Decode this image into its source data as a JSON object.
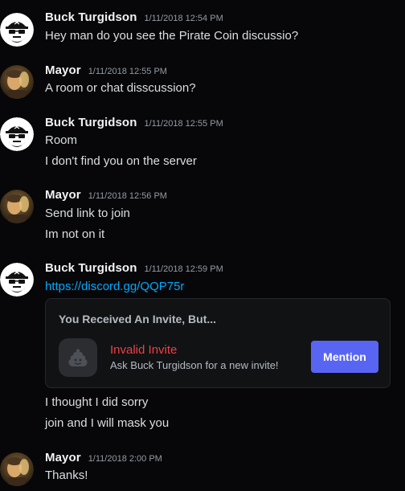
{
  "colors": {
    "background": "#070709",
    "username": "#f2f3f5",
    "timestamp": "#949ba4",
    "text": "#dbdee1",
    "link": "#00a8fc",
    "invalid": "#f23f42",
    "button": "#5865f2"
  },
  "messages": [
    {
      "author": "Buck Turgidson",
      "avatar": "pirate-skull-avatar",
      "timestamp": "1/11/2018 12:54 PM",
      "lines": [
        "Hey man do you see the Pirate Coin discussio?"
      ]
    },
    {
      "author": "Mayor",
      "avatar": "mayor-avatar",
      "timestamp": "1/11/2018 12:55 PM",
      "lines": [
        "A room or chat disscussion?"
      ]
    },
    {
      "author": "Buck Turgidson",
      "avatar": "pirate-skull-avatar",
      "timestamp": "1/11/2018 12:55 PM",
      "lines": [
        "Room",
        "I don't find you on the server"
      ]
    },
    {
      "author": "Mayor",
      "avatar": "mayor-avatar",
      "timestamp": "1/11/2018 12:56 PM",
      "lines": [
        "Send link to join",
        "Im not on it"
      ]
    },
    {
      "author": "Buck Turgidson",
      "avatar": "pirate-skull-avatar",
      "timestamp": "1/11/2018 12:59 PM",
      "link": "https://discord.gg/QQP75r",
      "invite": {
        "heading": "You Received An Invite, But...",
        "icon": "poop-icon",
        "title": "Invalid Invite",
        "subtitle": "Ask Buck Turgidson for a new invite!",
        "button": "Mention"
      },
      "lines": [
        "I thought I did sorry",
        "join and I will mask you"
      ]
    },
    {
      "author": "Mayor",
      "avatar": "mayor-avatar",
      "timestamp": "1/11/2018 2:00 PM",
      "lines": [
        "Thanks!"
      ]
    }
  ]
}
